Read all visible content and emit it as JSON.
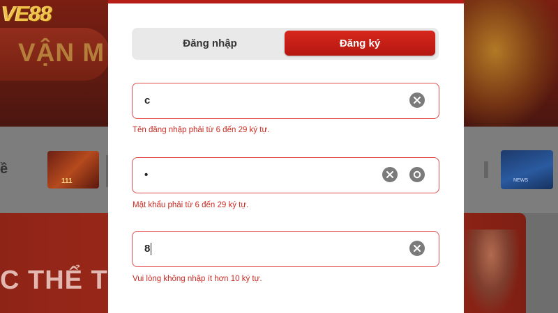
{
  "background": {
    "logo": "VE88",
    "hero_text": "VẬN M",
    "side_text": "ề",
    "thumb_left_caption": "111",
    "thumb_right_caption": "NEWS",
    "sports_text": "C THỂ TH"
  },
  "modal": {
    "tabs": [
      {
        "label": "Đăng nhập",
        "active": false
      },
      {
        "label": "Đăng ký",
        "active": true
      }
    ],
    "fields": [
      {
        "value": "c",
        "error": "Tên đăng nhập phải từ 6 đến 29 ký tự.",
        "icons": [
          "clear-icon"
        ]
      },
      {
        "value": "•",
        "error": "Mật khẩu phải từ 6 đến 29 ký tự.",
        "icons": [
          "clear-icon",
          "eye-icon"
        ]
      },
      {
        "value": "8",
        "error": "Vui lòng không nhập ít hơn 10 ký tự.",
        "icons": [
          "clear-icon"
        ]
      }
    ]
  },
  "colors": {
    "accent": "#c81e16",
    "error_text": "#cc2a22",
    "field_border": "#e04a4a"
  }
}
